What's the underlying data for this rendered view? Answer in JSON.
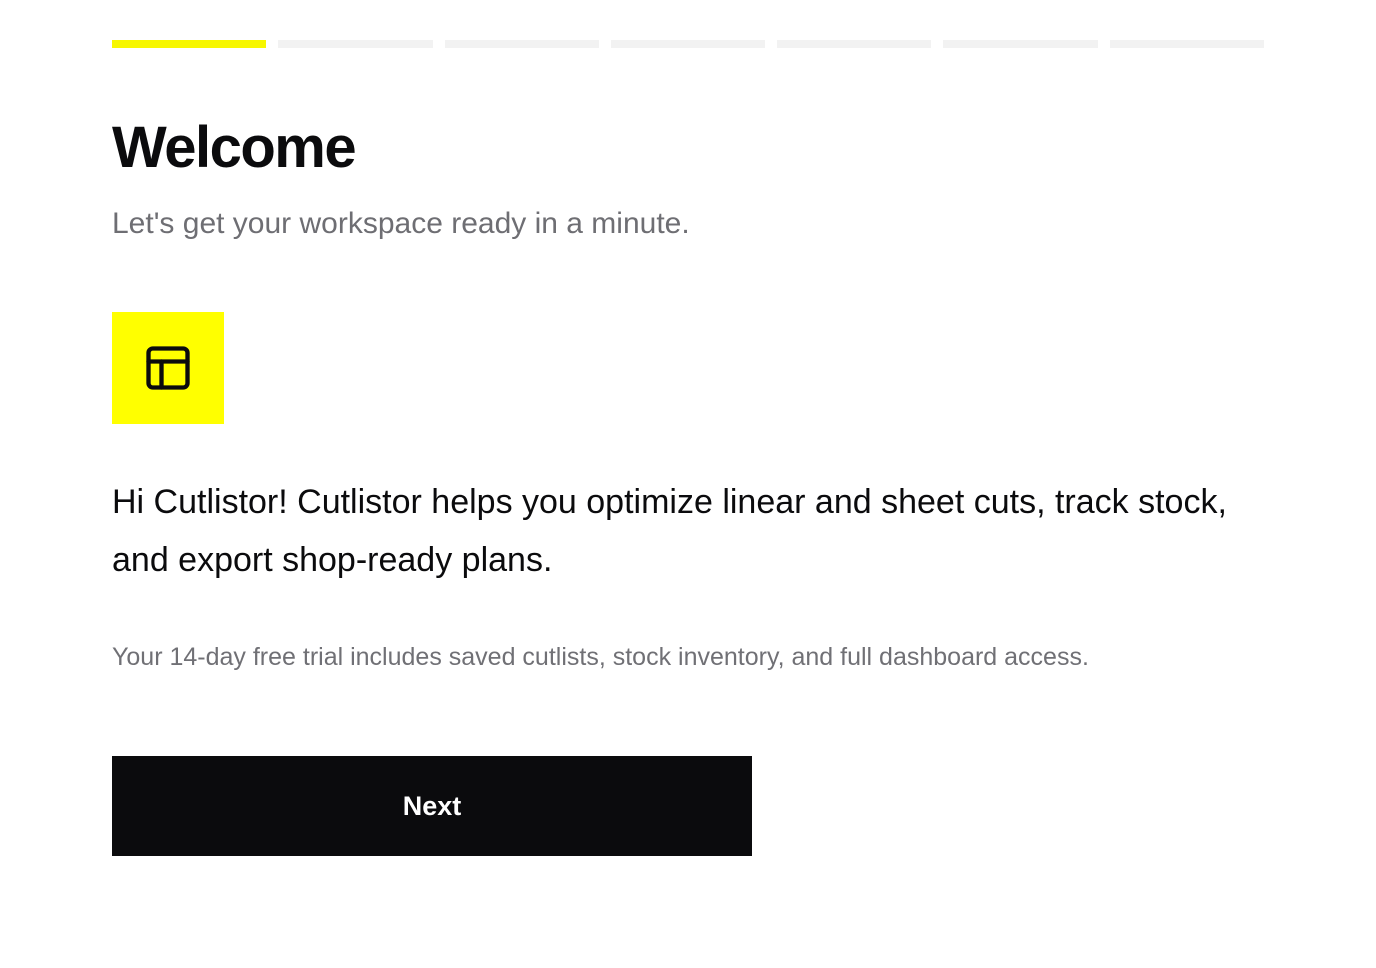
{
  "progress": {
    "total_steps": 7,
    "current_step": 1
  },
  "header": {
    "title": "Welcome",
    "subtitle": "Let's get your workspace ready in a minute."
  },
  "icon": {
    "name": "layout-panel-icon",
    "background": "#ffff00",
    "stroke": "#0b0b0d"
  },
  "body": {
    "intro": "Hi Cutlistor! Cutlistor helps you optimize linear and sheet cuts, track stock, and export shop-ready plans.",
    "trial_note": "Your 14-day free trial includes saved cutlists, stock inventory, and full dashboard access."
  },
  "actions": {
    "next_label": "Next"
  },
  "colors": {
    "accent": "#f7f700",
    "inactive_step": "#f2f2f2",
    "text_primary": "#0b0b0d",
    "text_secondary": "#6e6e73",
    "button_bg": "#0b0b0d"
  }
}
